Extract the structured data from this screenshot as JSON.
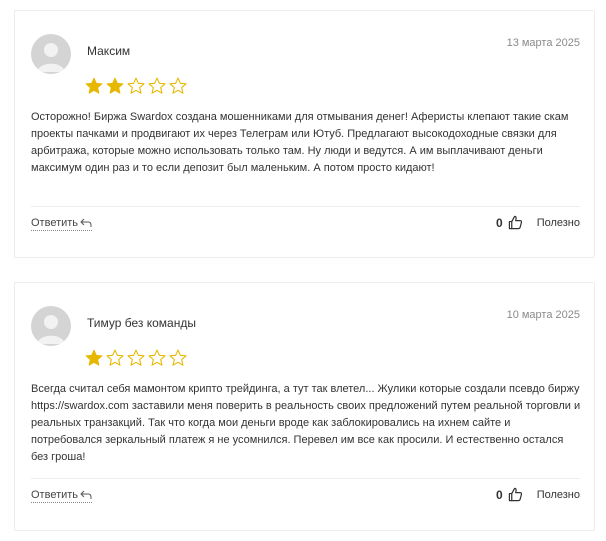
{
  "reviews": [
    {
      "author": "Максим",
      "date": "13 марта 2025",
      "rating": 2,
      "max_rating": 5,
      "text": "Осторожно! Биржа Swardox создана мошенниками для отмывания денег! Аферисты клепают такие скам проекты пачками и продвигают их через Телеграм или Ютуб. Предлагают высокодоходные связки для арбитража, которые можно использовать только там. Ну люди и ведутся. А им выплачивают деньги максимум один раз и то если депозит был маленьким. А потом просто кидают!",
      "reply_label": "Ответить",
      "votes": "0",
      "useful_label": "Полезно"
    },
    {
      "author": "Тимур без команды",
      "date": "10 марта 2025",
      "rating": 1,
      "max_rating": 5,
      "text": "Всегда считал себя мамонтом крипто трейдинга, а тут так влетел... Жулики которые создали псевдо биржу https://swardox.com заставили меня поверить в реальность своих предложений путем реальной торговли и реальных транзакций. Так что когда мои деньги вроде как заблокировались на ихнем сайте и потребовался зеркальный платеж я не усомнился. Перевел им все как просили. И естественно остался без гроша!",
      "reply_label": "Ответить",
      "votes": "0",
      "useful_label": "Полезно"
    }
  ],
  "colors": {
    "star_filled": "#e6b800",
    "star_empty_stroke": "#e6b800",
    "avatar_bg": "#d4d4d4",
    "card_border": "#ececec"
  },
  "icons": {
    "avatar": "user-avatar-icon",
    "star": "star-icon",
    "reply": "reply-arrow-icon",
    "like": "thumbs-up-icon"
  }
}
